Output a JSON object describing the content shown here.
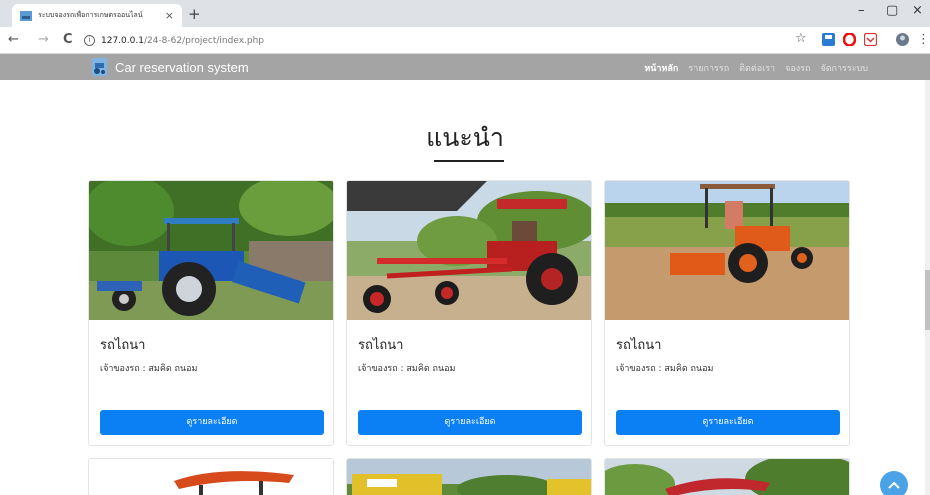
{
  "browser": {
    "tab_title": "ระบบจองรถเพื่อการเกษตรออนไลน์",
    "tab_close": "×",
    "new_tab": "+",
    "back": "←",
    "forward": "→",
    "reload": "C",
    "info": "i",
    "url_host": "127.0.0.1",
    "url_path": "/24-8-62/project/index.php",
    "star": "☆",
    "minimize": "–",
    "maximize": "▢",
    "close": "×",
    "menu": "⋮"
  },
  "site": {
    "brand": "Car reservation system",
    "nav": [
      "หน้าหลัก",
      "รายการรถ",
      "ติดต่อเรา",
      "จองรถ",
      "จัดการระบบ"
    ]
  },
  "main": {
    "heading": "แนะนำ",
    "cards": [
      {
        "title": "รถไถนา",
        "owner": "เจ้าของรถ : สมคิด ถนอม",
        "button": "ดูรายละเอียด"
      },
      {
        "title": "รถไถนา",
        "owner": "เจ้าของรถ : สมคิด ถนอม",
        "button": "ดูรายละเอียด"
      },
      {
        "title": "รถไถนา",
        "owner": "เจ้าของรถ : สมคิด ถนอม",
        "button": "ดูรายละเอียด"
      }
    ]
  },
  "colors": {
    "navbar": "#a4a4a4",
    "button": "#0b7ff4",
    "scroll_top": "#4aa3e6"
  }
}
